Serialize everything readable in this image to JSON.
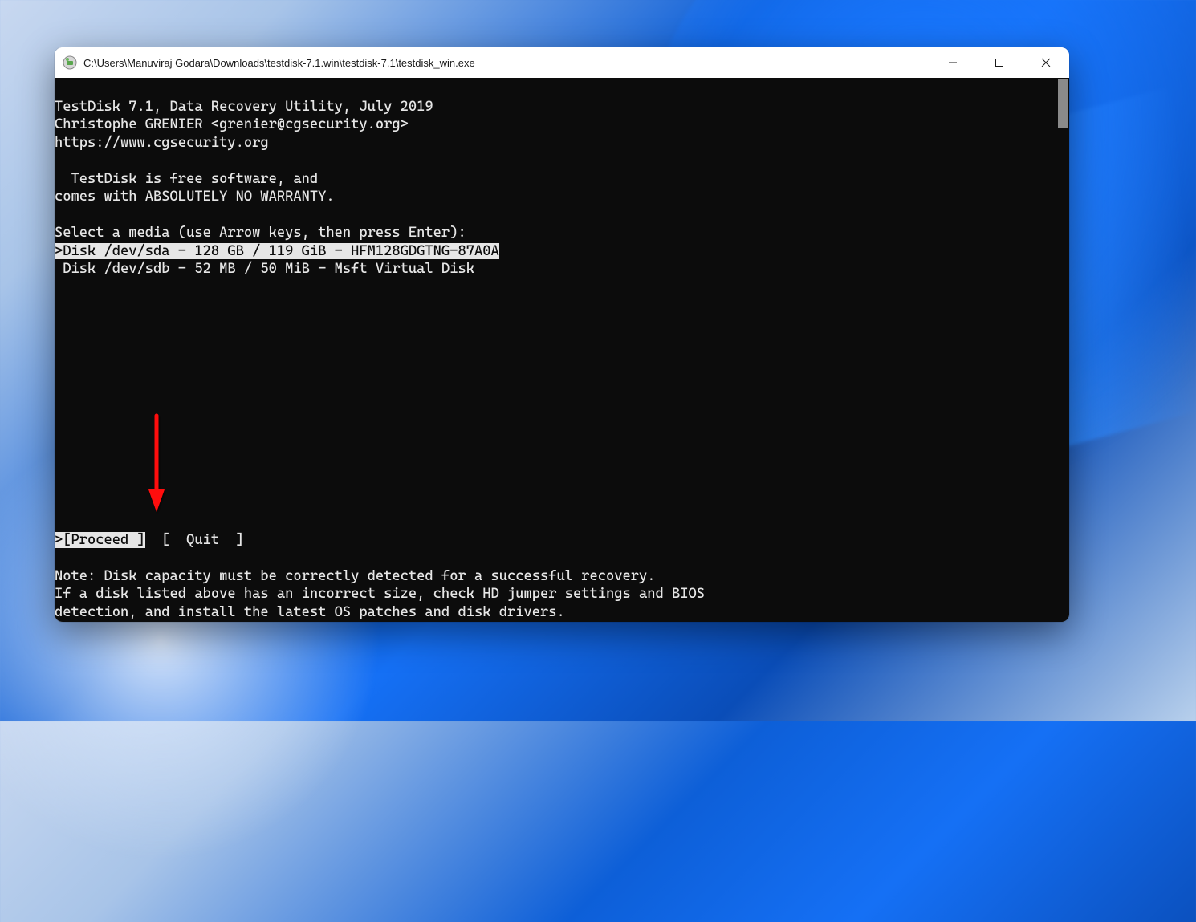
{
  "window": {
    "title": "C:\\Users\\Manuviraj Godara\\Downloads\\testdisk-7.1.win\\testdisk-7.1\\testdisk_win.exe"
  },
  "terminal": {
    "header1": "TestDisk 7.1, Data Recovery Utility, July 2019",
    "header2": "Christophe GRENIER <grenier@cgsecurity.org>",
    "header3": "https://www.cgsecurity.org",
    "free1": "  TestDisk is free software, and",
    "free2": "comes with ABSOLUTELY NO WARRANTY.",
    "select_prompt": "Select a media (use Arrow keys, then press Enter):",
    "disks": [
      {
        "text": ">Disk /dev/sda - 128 GB / 119 GiB - HFM128GDGTNG-87A0A",
        "selected": true
      },
      {
        "text": " Disk /dev/sdb - 52 MB / 50 MiB - Msft Virtual Disk",
        "selected": false
      }
    ],
    "menu": {
      "proceed": ">[Proceed ]",
      "quit": "[  Quit  ]"
    },
    "note1": "Note: Disk capacity must be correctly detected for a successful recovery.",
    "note2": "If a disk listed above has an incorrect size, check HD jumper settings and BIOS",
    "note3": "detection, and install the latest OS patches and disk drivers."
  },
  "annotation": {
    "arrow_color": "#ff0a0a"
  }
}
